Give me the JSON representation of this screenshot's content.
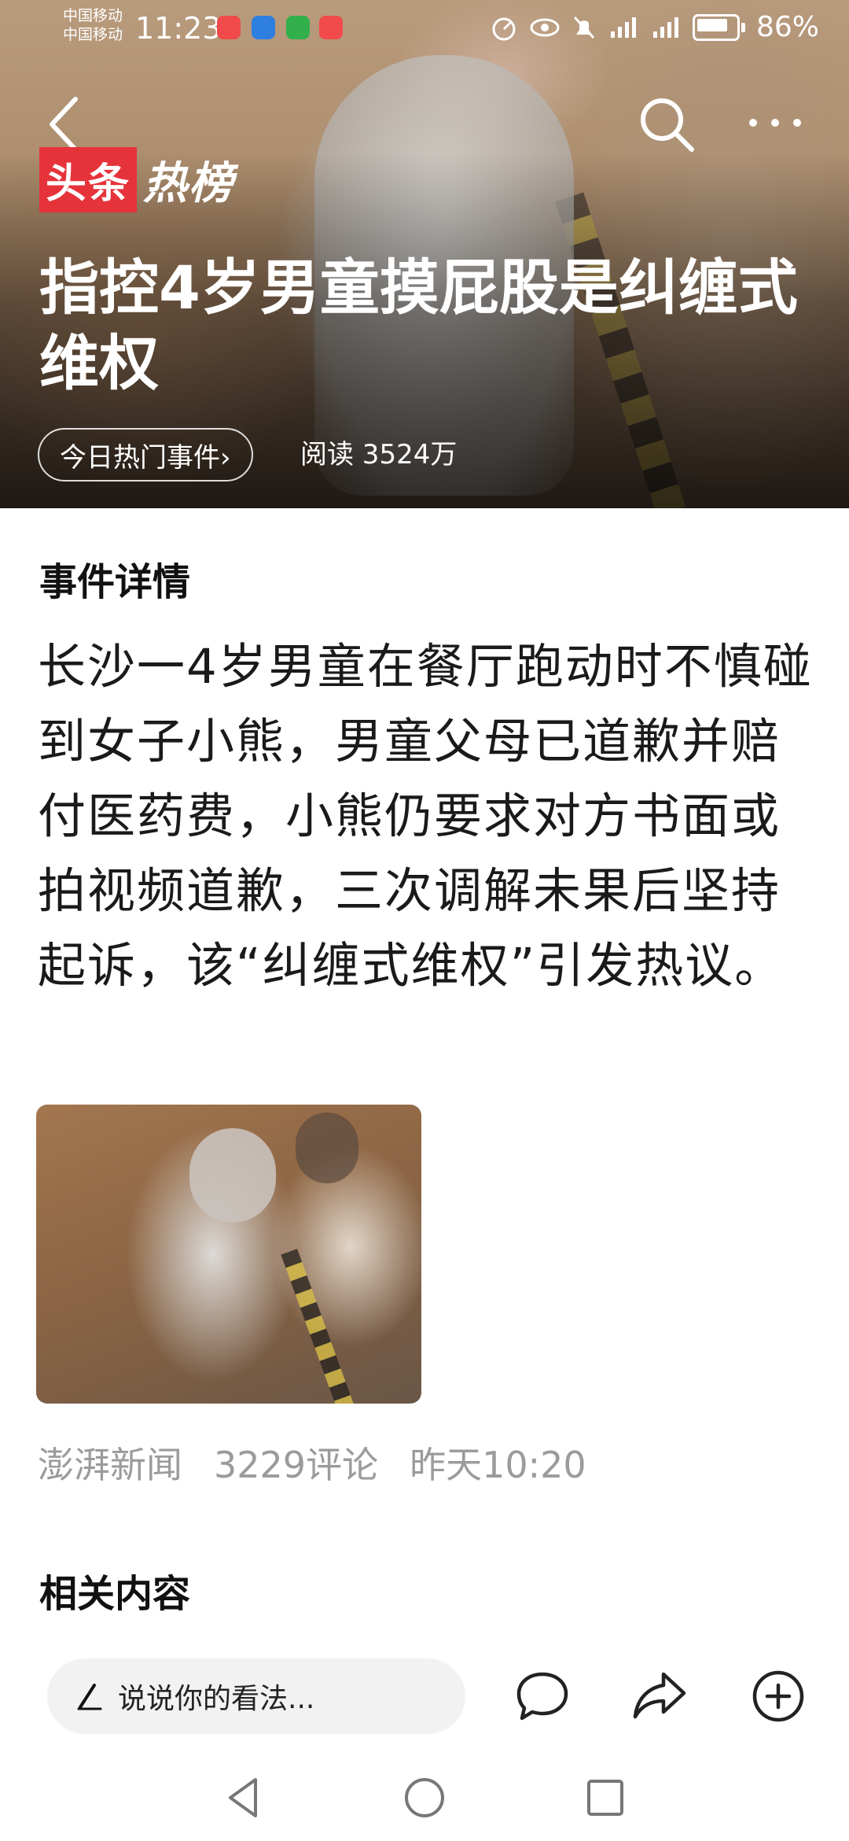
{
  "status_bar": {
    "carrier_1": "中国移动",
    "carrier_2": "中国移动",
    "time": "11:23",
    "battery": "86%"
  },
  "nav": {
    "back_icon": "back-chevron-icon",
    "search_icon": "search-icon",
    "more_icon": "more-dots-icon"
  },
  "brand": {
    "part1": "头条",
    "part2": "热榜"
  },
  "headline": "指控4岁男童摸屁股是纠缠式维权",
  "event_pill": "今日热门事件›",
  "reads": "阅读 3524万",
  "details": {
    "title": "事件详情",
    "summary": "长沙一4岁男童在餐厅跑动时不慎碰到女子小熊，男童父母已道歉并赔付医药费，小熊仍要求对方书面或拍视频道歉，三次调解未果后坚持起诉，该“纠缠式维权”引发热议。"
  },
  "meta": {
    "source": "澎湃新闻",
    "comments": "3229评论",
    "time": "昨天10:20"
  },
  "related": {
    "title": "相关内容"
  },
  "bottom_bar": {
    "comment_placeholder": "说说你的看法...",
    "actions": [
      "comment-icon",
      "share-icon",
      "add-icon"
    ]
  },
  "colors": {
    "brand_red": "#e6333a",
    "meta_gray": "#9b9b9b"
  }
}
